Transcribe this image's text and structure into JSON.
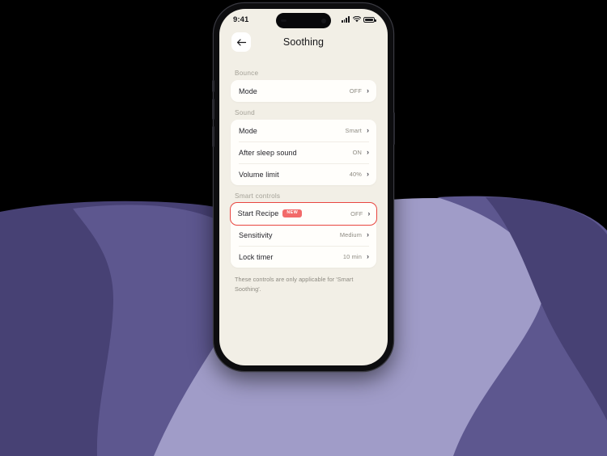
{
  "background": {
    "canvas_color": "#000000",
    "blob_light": "#a09cc8",
    "blob_mid": "#5d578f",
    "blob_dark": "#474174"
  },
  "phone": {
    "frame_color": "#0d0d0f",
    "screen_bg": "#f2efe6"
  },
  "statusbar": {
    "time": "9:41",
    "signal_icon": "cellular-signal-icon",
    "wifi_icon": "wifi-icon",
    "battery_icon": "battery-icon"
  },
  "nav": {
    "back_icon": "back-arrow-icon",
    "title": "Soothing"
  },
  "sections": [
    {
      "label": "Bounce",
      "rows": [
        {
          "label": "Mode",
          "value": "OFF",
          "badge": null,
          "highlighted": false
        }
      ]
    },
    {
      "label": "Sound",
      "rows": [
        {
          "label": "Mode",
          "value": "Smart",
          "badge": null,
          "highlighted": false
        },
        {
          "label": "After sleep sound",
          "value": "ON",
          "badge": null,
          "highlighted": false
        },
        {
          "label": "Volume limit",
          "value": "40%",
          "badge": null,
          "highlighted": false
        }
      ]
    },
    {
      "label": "Smart controls",
      "rows": [
        {
          "label": "Start Recipe",
          "value": "OFF",
          "badge": "NEW",
          "highlighted": true
        },
        {
          "label": "Sensitivity",
          "value": "Medium",
          "badge": null,
          "highlighted": false
        },
        {
          "label": "Lock timer",
          "value": "10 min",
          "badge": null,
          "highlighted": false
        }
      ]
    }
  ],
  "footnote": "These controls are only applicable for 'Smart Soothing'.",
  "colors": {
    "highlight_border": "#e8453f",
    "badge_bg": "#f26a6a",
    "section_label": "#a3a096",
    "value_text": "#8d8a81",
    "card_bg": "#fffefb"
  }
}
